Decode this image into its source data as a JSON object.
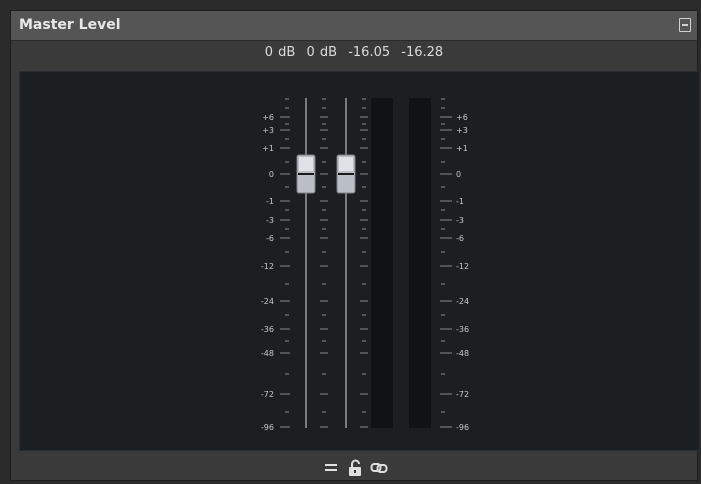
{
  "panel": {
    "title": "Master Level"
  },
  "readouts": {
    "peak_left": "0 dB",
    "peak_right": "0 dB",
    "level_left": "-16.05",
    "level_right": "-16.28"
  },
  "scale": {
    "left_labels": [
      "+6",
      "+3",
      "+1",
      "0",
      "-1",
      "-3",
      "-6",
      "-12",
      "-24",
      "-36",
      "-48",
      "-72",
      "-96"
    ],
    "right_labels": [
      "+6",
      "+3",
      "+1",
      "0",
      "-1",
      "-3",
      "-6",
      "-12",
      "-24",
      "-36",
      "-48",
      "-72",
      "-96"
    ]
  },
  "faders": {
    "left_value": "0 dB",
    "right_value": "0 dB"
  },
  "toolbar": {
    "buttons": [
      {
        "name": "equal-faders-icon"
      },
      {
        "name": "unlock-icon"
      },
      {
        "name": "link-icon"
      }
    ]
  }
}
